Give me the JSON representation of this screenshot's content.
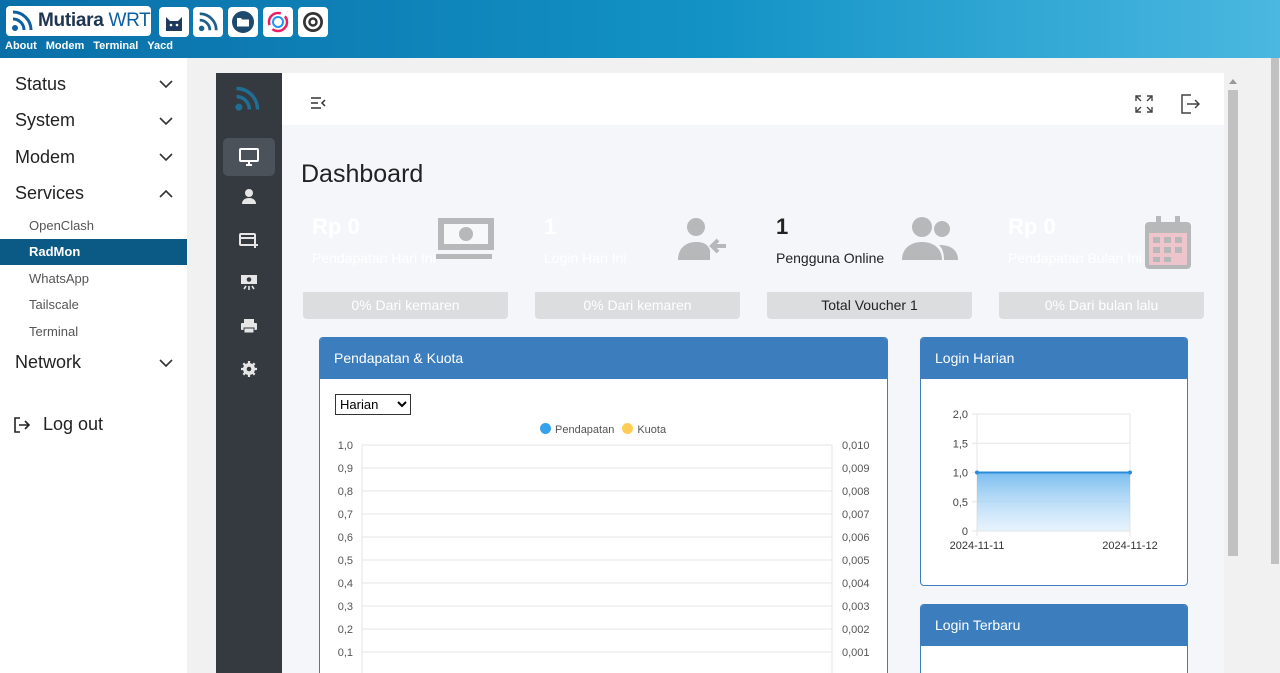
{
  "header": {
    "brand_main": "Mutiara",
    "brand_sub": "WRT",
    "links": [
      "About",
      "Modem",
      "Terminal",
      "Yacd"
    ]
  },
  "sidebar": {
    "items": [
      {
        "label": "Status"
      },
      {
        "label": "System"
      },
      {
        "label": "Modem"
      },
      {
        "label": "Services"
      }
    ],
    "services_sub": [
      "OpenClash",
      "RadMon",
      "WhatsApp",
      "Tailscale",
      "Terminal"
    ],
    "active_sub": "RadMon",
    "network_label": "Network",
    "logout_label": "Log out"
  },
  "dashboard": {
    "title": "Dashboard",
    "cards": [
      {
        "value": "Rp 0",
        "label": "Pendapatan Hari Ini",
        "footer": "0% Dari kemaren",
        "color": "#0d6efd"
      },
      {
        "value": "1",
        "label": "Login Hari Ini",
        "footer": "0% Dari kemaren",
        "color": "#198754"
      },
      {
        "value": "1",
        "label": "Pengguna Online",
        "footer": "Total Voucher 1",
        "color": "#ffc107"
      },
      {
        "value": "Rp 0",
        "label": "Pendapatan Bulan Ini",
        "footer": "0% Dari bulan lalu",
        "color": "#dc3545"
      }
    ],
    "revenue_panel": {
      "title": "Pendapatan & Kuota",
      "select_value": "Harian"
    },
    "login_panel": {
      "title": "Login Harian"
    },
    "latest_panel": {
      "title": "Login Terbaru"
    }
  },
  "chart_data": [
    {
      "type": "line",
      "legend": [
        "Pendapatan",
        "Kuota"
      ],
      "legend_colors": [
        "#36a2eb",
        "#ffcd56"
      ],
      "y_left_ticks": [
        "1,0",
        "0,9",
        "0,8",
        "0,7",
        "0,6",
        "0,5",
        "0,4",
        "0,3",
        "0,2",
        "0,1"
      ],
      "y_right_ticks": [
        "0,010",
        "0,009",
        "0,008",
        "0,007",
        "0,006",
        "0,005",
        "0,004",
        "0,003",
        "0,002",
        "0,001"
      ],
      "series": []
    },
    {
      "type": "area",
      "categories": [
        "2024-11-11",
        "2024-11-12"
      ],
      "values": [
        1,
        1
      ],
      "y_ticks": [
        "2,0",
        "1,5",
        "1,0",
        "0,5",
        "0"
      ],
      "ylim": [
        0,
        2
      ]
    }
  ]
}
